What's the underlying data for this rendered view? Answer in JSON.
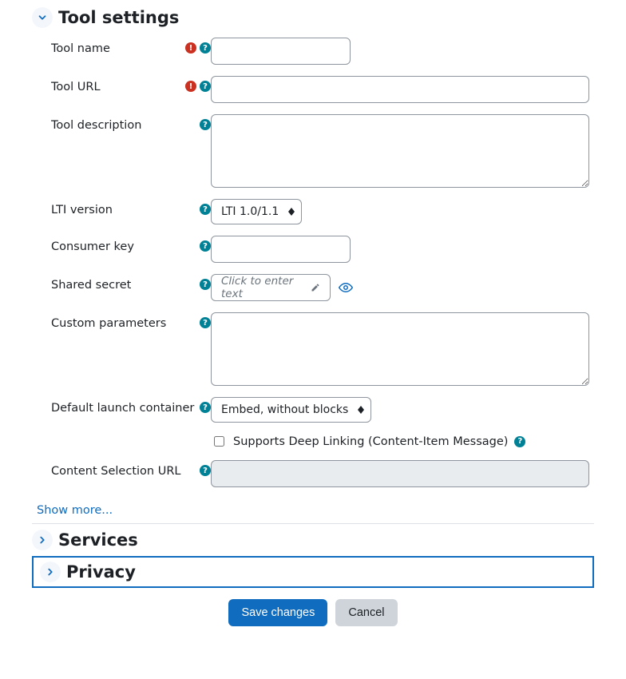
{
  "sections": {
    "tool_settings": {
      "title": "Tool settings"
    },
    "services": {
      "title": "Services"
    },
    "privacy": {
      "title": "Privacy"
    }
  },
  "fields": {
    "tool_name": {
      "label": "Tool name",
      "value": ""
    },
    "tool_url": {
      "label": "Tool URL",
      "value": ""
    },
    "tool_desc": {
      "label": "Tool description",
      "value": ""
    },
    "lti_version": {
      "label": "LTI version",
      "selected": "LTI 1.0/1.1"
    },
    "consumer_key": {
      "label": "Consumer key",
      "value": ""
    },
    "shared_secret": {
      "label": "Shared secret",
      "placeholder": "Click to enter text"
    },
    "custom_params": {
      "label": "Custom parameters",
      "value": ""
    },
    "launch_container": {
      "label": "Default launch container",
      "selected": "Embed, without blocks"
    },
    "deep_linking": {
      "label": "Supports Deep Linking (Content-Item Message)"
    },
    "content_sel_url": {
      "label": "Content Selection URL",
      "value": ""
    }
  },
  "links": {
    "show_more": "Show more..."
  },
  "buttons": {
    "save": "Save changes",
    "cancel": "Cancel"
  }
}
